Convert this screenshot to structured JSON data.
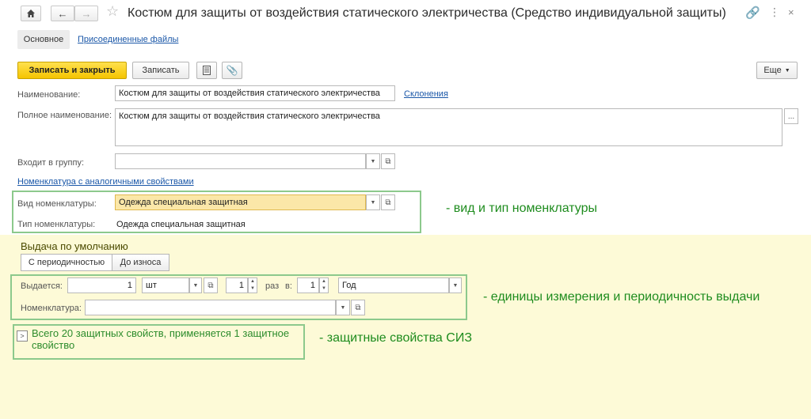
{
  "window": {
    "title": "Костюм для защиты от воздействия статического электричества (Средство индивидуальной защиты)"
  },
  "tabs": [
    {
      "label": "Основное"
    },
    {
      "label": "Присоединенные файлы"
    }
  ],
  "toolbar": {
    "save_close_label": "Записать и закрыть",
    "save_label": "Записать",
    "more_label": "Еще"
  },
  "form": {
    "name_label": "Наименование:",
    "name_value": "Костюм для защиты от воздействия статического электричества",
    "declensions_link": "Склонения",
    "full_name_label": "Полное наименование:",
    "full_name_value": "Костюм для защиты от воздействия статического электричества",
    "group_label": "Входит в группу:",
    "group_value": "",
    "similar_link": "Номенклатура с аналогичными свойствами",
    "kind_label": "Вид номенклатуры:",
    "kind_value": "Одежда специальная защитная",
    "type_label": "Тип номенклатуры:",
    "type_value": "Одежда специальная защитная"
  },
  "issue": {
    "header": "Выдача по умолчанию",
    "mode_tabs": [
      {
        "label": "С периодичностью"
      },
      {
        "label": "До износа"
      }
    ],
    "issued_label": "Выдается:",
    "qty_value": "1",
    "unit_value": "шт",
    "times_value": "1",
    "times_label": "раз",
    "in_label": "в:",
    "period_qty_value": "1",
    "period_value": "Год",
    "nomenclature_label": "Номенклатура:",
    "nomenclature_value": ""
  },
  "properties": {
    "summary": "Всего 20 защитных свойств, применяется 1 защитное свойство"
  },
  "annotations": {
    "kind_type": "- вид и тип номенклатуры",
    "units_period": "- единицы измерения и периодичность выдачи",
    "protective": "- защитные свойства СИЗ"
  },
  "colors": {
    "primary_button": "#f5c400",
    "annotation": "#1e8c1e",
    "highlight_field": "#fbe7a8",
    "link": "#1a57a8"
  }
}
